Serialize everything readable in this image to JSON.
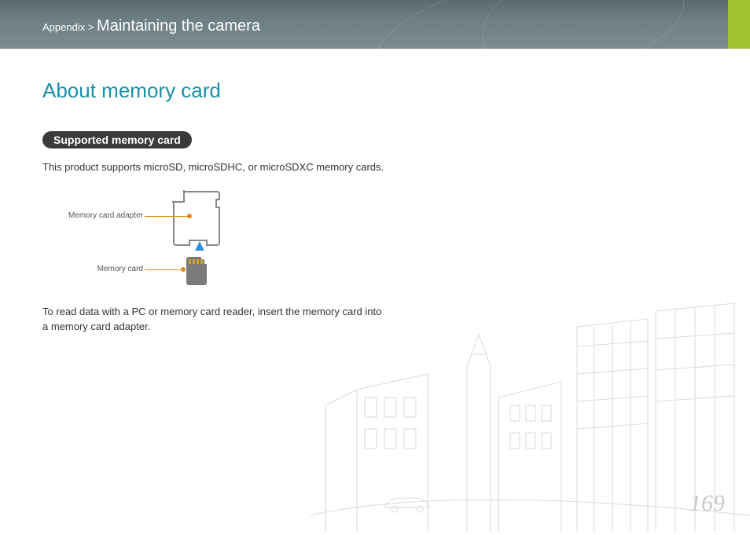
{
  "breadcrumb": {
    "prefix": "Appendix >",
    "section": "Maintaining the camera"
  },
  "title": "About memory card",
  "subheading": "Supported memory card",
  "intro": "This product supports microSD, microSDHC, or microSDXC memory cards.",
  "diagram": {
    "label_adapter": "Memory card adapter",
    "label_card": "Memory card"
  },
  "note": "To read data with a PC or memory card reader, insert the memory card into a memory card adapter.",
  "page_number": "169"
}
